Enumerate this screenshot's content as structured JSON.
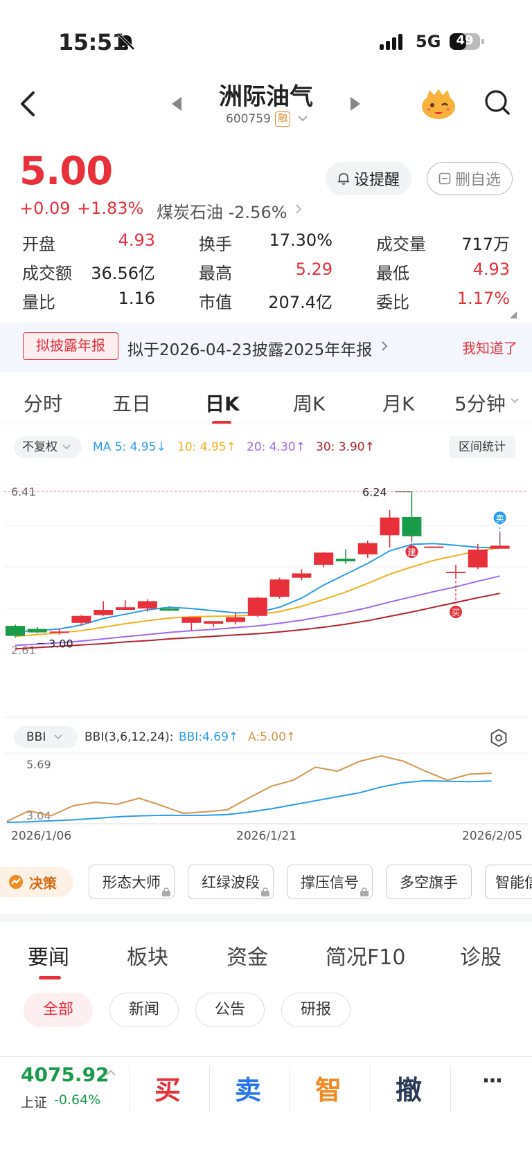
{
  "status_bar": {
    "time": "15:51",
    "network": "5G",
    "battery": "49"
  },
  "header": {
    "title": "洲际油气",
    "code": "600759",
    "margin_badge": "融"
  },
  "quote": {
    "price": "5.00",
    "change": "+0.09",
    "change_pct": "+1.83%",
    "sector": "煤炭石油 -2.56%",
    "alert_label": "设提醒",
    "watchlist_label": "删自选",
    "stats": [
      {
        "label": "开盘",
        "value": "4.93",
        "color": "#e8303b"
      },
      {
        "label": "换手",
        "value": "17.30%",
        "color": "#222222"
      },
      {
        "label": "成交量",
        "value": "717万",
        "color": "#222222"
      },
      {
        "label": "成交额",
        "value": "36.56亿",
        "color": "#222222"
      },
      {
        "label": "最高",
        "value": "5.29",
        "color": "#e8303b"
      },
      {
        "label": "最低",
        "value": "4.93",
        "color": "#e8303b"
      },
      {
        "label": "量比",
        "value": "1.16",
        "color": "#222222"
      },
      {
        "label": "市值",
        "value": "207.4亿",
        "color": "#222222"
      },
      {
        "label": "委比",
        "value": "1.17%",
        "color": "#e8303b"
      }
    ]
  },
  "banner": {
    "tag": "拟披露年报",
    "text": "拟于2026-04-23披露2025年年报",
    "dismiss": "我知道了"
  },
  "period_tabs": [
    "分时",
    "五日",
    "日K",
    "周K",
    "月K",
    "5分钟"
  ],
  "ma_row": {
    "adjust": "不复权",
    "ma5": "MA 5: 4.95↓",
    "ma10": "10: 4.95↑",
    "ma20": "20: 4.30↑",
    "ma30": "30: 3.90↑",
    "range_stats": "区间统计"
  },
  "colors": {
    "up": "#e8303b",
    "down": "#1a9b4a",
    "ma5": "#2a9de8",
    "ma10": "#f0b21c",
    "ma20": "#9e6bf0",
    "ma30": "#b5232d",
    "bbi": "#2a9de8",
    "a_line": "#d4964a"
  },
  "bbi_row": {
    "selector": "BBI",
    "params": "BBI(3,6,12,24):",
    "bbi": "BBI:4.69↑",
    "a": "A:5.00↑"
  },
  "chart_data": [
    {
      "type": "candlestick",
      "y_axis_labels": [
        "6.41",
        "2.61"
      ],
      "ylim": [
        2.61,
        6.41
      ],
      "ohlc": [
        [
          3.15,
          3.18,
          2.88,
          2.92
        ],
        [
          3.08,
          3.12,
          2.98,
          3.0
        ],
        [
          3.0,
          3.08,
          2.95,
          3.02
        ],
        [
          3.22,
          3.4,
          3.16,
          3.38
        ],
        [
          3.4,
          3.72,
          3.38,
          3.52
        ],
        [
          3.52,
          3.74,
          3.52,
          3.58
        ],
        [
          3.55,
          3.76,
          3.48,
          3.72
        ],
        [
          3.55,
          3.6,
          3.5,
          3.5
        ],
        [
          3.22,
          3.28,
          3.04,
          3.35
        ],
        [
          3.2,
          3.25,
          3.12,
          3.26
        ],
        [
          3.24,
          3.46,
          3.18,
          3.35
        ],
        [
          3.38,
          3.82,
          3.36,
          3.8
        ],
        [
          3.82,
          4.26,
          3.78,
          4.22
        ],
        [
          4.26,
          4.46,
          4.2,
          4.36
        ],
        [
          4.56,
          4.86,
          4.5,
          4.84
        ],
        [
          4.7,
          4.92,
          4.58,
          4.64
        ],
        [
          4.8,
          5.12,
          4.72,
          5.06
        ],
        [
          5.24,
          5.82,
          4.96,
          5.65
        ],
        [
          5.66,
          6.24,
          5.12,
          5.22
        ],
        [
          4.98,
          4.98,
          4.98,
          4.98
        ],
        [
          4.4,
          4.56,
          4.28,
          4.4
        ],
        [
          4.5,
          5.04,
          4.46,
          4.91
        ],
        [
          4.93,
          5.29,
          4.93,
          5.0
        ]
      ],
      "ma5": [
        3.02,
        3.04,
        3.08,
        3.17,
        3.32,
        3.42,
        3.52,
        3.58,
        3.55,
        3.5,
        3.45,
        3.46,
        3.58,
        3.79,
        4.09,
        4.34,
        4.59,
        4.88,
        5.03,
        5.05,
        5.01,
        4.96,
        4.95
      ],
      "ma10": [
        2.91,
        2.95,
        2.99,
        3.04,
        3.12,
        3.2,
        3.27,
        3.33,
        3.36,
        3.37,
        3.38,
        3.41,
        3.48,
        3.6,
        3.76,
        3.93,
        4.13,
        4.34,
        4.51,
        4.66,
        4.77,
        4.88,
        4.95
      ],
      "ma20": [
        2.7,
        2.73,
        2.76,
        2.8,
        2.85,
        2.9,
        2.95,
        3.0,
        3.04,
        3.07,
        3.11,
        3.15,
        3.21,
        3.28,
        3.37,
        3.46,
        3.57,
        3.7,
        3.82,
        3.94,
        4.05,
        4.18,
        4.3
      ],
      "ma30": [
        2.62,
        2.65,
        2.68,
        2.71,
        2.74,
        2.78,
        2.81,
        2.85,
        2.88,
        2.91,
        2.94,
        2.97,
        3.01,
        3.06,
        3.12,
        3.19,
        3.27,
        3.37,
        3.47,
        3.58,
        3.69,
        3.8,
        3.9
      ],
      "annotations": [
        "6.24",
        "3.00",
        "建",
        "买",
        "卖"
      ]
    },
    {
      "type": "line",
      "y_axis_labels": [
        "5.69",
        "3.04"
      ],
      "ylim": [
        3.04,
        5.69
      ],
      "series": [
        {
          "name": "BBI",
          "values": [
            3.04,
            3.06,
            3.1,
            3.14,
            3.2,
            3.26,
            3.3,
            3.32,
            3.32,
            3.32,
            3.35,
            3.45,
            3.58,
            3.74,
            3.9,
            4.06,
            4.22,
            4.45,
            4.62,
            4.7,
            4.68,
            4.66,
            4.69
          ]
        },
        {
          "name": "A",
          "values": [
            3.08,
            3.5,
            3.3,
            3.7,
            3.84,
            3.76,
            4.0,
            3.72,
            3.4,
            3.46,
            3.54,
            4.02,
            4.48,
            4.72,
            5.24,
            5.08,
            5.47,
            5.69,
            5.48,
            5.08,
            4.72,
            4.96,
            5.0
          ]
        }
      ],
      "x_labels": [
        "2026/1/06",
        "2026/1/21",
        "2026/2/05"
      ]
    }
  ],
  "tools": {
    "decision": "决策",
    "items": [
      "形态大师",
      "红绿波段",
      "撑压信号",
      "多空旗手",
      "智能信"
    ]
  },
  "news_tabs": [
    "要闻",
    "板块",
    "资金",
    "简况F10",
    "诊股"
  ],
  "news_chips": [
    "全部",
    "新闻",
    "公告",
    "研报"
  ],
  "bottom_bar": {
    "index_value": "4075.92",
    "index_name": "上证",
    "index_change": "-0.64%",
    "buy": "买",
    "sell": "卖",
    "smart": "智",
    "cancel": "撤",
    "more": "···"
  }
}
